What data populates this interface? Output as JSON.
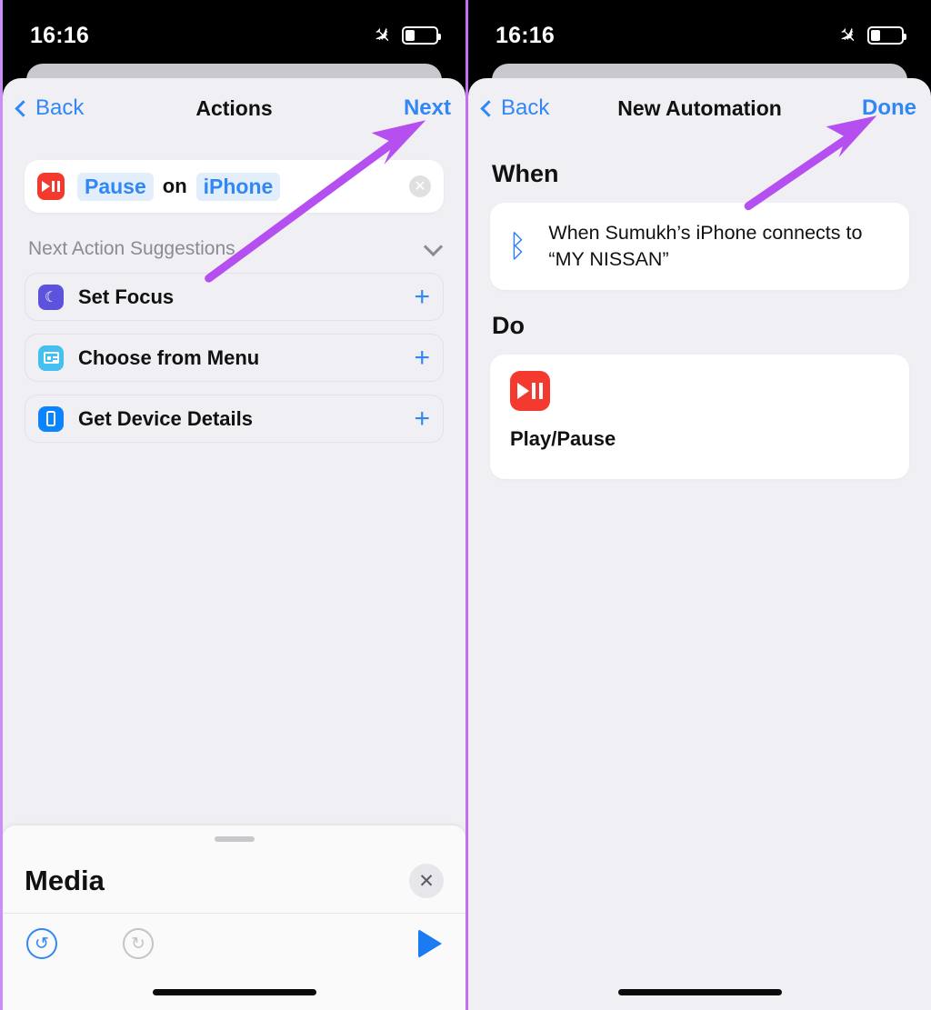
{
  "status_bar": {
    "time": "16:16",
    "airplane_icon": "airplane-mode-icon",
    "battery_icon": "battery-icon",
    "battery_level_pct": 32
  },
  "colors": {
    "accent_blue": "#3187f5",
    "annotation_purple": "#b64ff0",
    "media_red": "#f4392f",
    "bluetooth_blue": "#2d7ff9",
    "sheet_background": "#f0eff4",
    "card_white": "#ffffff"
  },
  "left_screen": {
    "nav": {
      "back_label": "Back",
      "back_icon": "chevron-left-icon",
      "title": "Actions",
      "action_label": "Next"
    },
    "action": {
      "app_icon": "play-pause-icon",
      "verb_token": "Pause",
      "connector": "on",
      "target_token": "iPhone",
      "clear_icon": "clear-circle-icon"
    },
    "suggestions": {
      "header": "Next Action Suggestions",
      "collapse_icon": "chevron-down-icon",
      "add_icon": "plus-icon",
      "items": [
        {
          "label": "Set Focus",
          "icon": "moon-icon",
          "icon_color": "#5b52dd"
        },
        {
          "label": "Choose from Menu",
          "icon": "menu-card-icon",
          "icon_color": "#43c0ef"
        },
        {
          "label": "Get Device Details",
          "icon": "phone-icon",
          "icon_color": "#0a84ff"
        }
      ]
    },
    "drawer": {
      "grabber": "drawer-grabber",
      "title": "Media",
      "close_icon": "close-icon",
      "undo_icon": "undo-icon",
      "redo_icon": "redo-icon",
      "play_icon": "play-icon"
    }
  },
  "right_screen": {
    "nav": {
      "back_label": "Back",
      "back_icon": "chevron-left-icon",
      "title": "New Automation",
      "action_label": "Done"
    },
    "when": {
      "heading": "When",
      "trigger_icon": "bluetooth-icon",
      "trigger_text": "When Sumukh’s iPhone connects to “MY NISSAN”"
    },
    "do": {
      "heading": "Do",
      "action_icon": "play-pause-icon",
      "action_label": "Play/Pause"
    }
  },
  "annotations": {
    "left_arrow": "arrow-pointing-to-next-button",
    "right_arrow": "arrow-pointing-to-done-button"
  }
}
